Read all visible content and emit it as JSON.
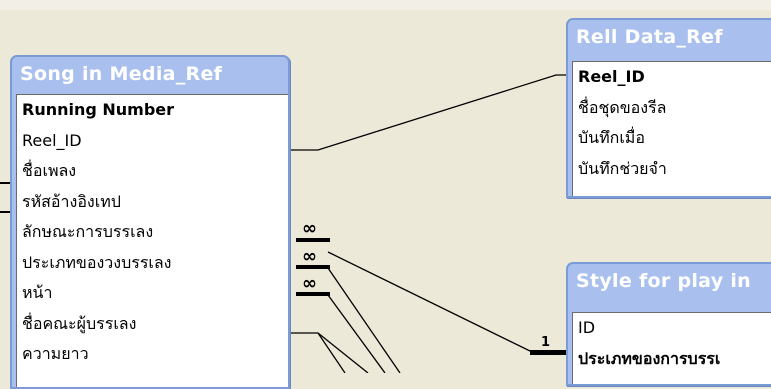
{
  "tables": {
    "song": {
      "title": "Song in Media_Ref",
      "fields": [
        {
          "name": "Running Number",
          "key": true
        },
        {
          "name": "Reel_ID",
          "key": false
        },
        {
          "name": "ชื่อเพลง",
          "key": false
        },
        {
          "name": "รหัสอ้างอิงเทป",
          "key": false
        },
        {
          "name": "ลักษณะการบรรเลง",
          "key": false
        },
        {
          "name": "ประเภทของวงบรรเลง",
          "key": false
        },
        {
          "name": "หน้า",
          "key": false
        },
        {
          "name": "ชื่อคณะผู้บรรเลง",
          "key": false
        },
        {
          "name": "ความยาว",
          "key": false
        }
      ]
    },
    "reel": {
      "title": "Rell Data_Ref",
      "fields": [
        {
          "name": "Reel_ID",
          "key": true
        },
        {
          "name": "ชื่อชุดของรีล",
          "key": false
        },
        {
          "name": "บันทึกเมื่อ",
          "key": false
        },
        {
          "name": "บันทึกช่วยจำ",
          "key": false
        }
      ]
    },
    "style": {
      "title": "Style for play in",
      "fields": [
        {
          "name": "ID",
          "key": false
        },
        {
          "name": "ประเภทของการบรรเ",
          "key": true
        }
      ]
    }
  },
  "relationships": {
    "many_symbol": "∞",
    "one_symbol": "1"
  },
  "colors": {
    "background": "#ECE9D8",
    "title_bar": "#A9C0EE",
    "line": "#000000"
  }
}
